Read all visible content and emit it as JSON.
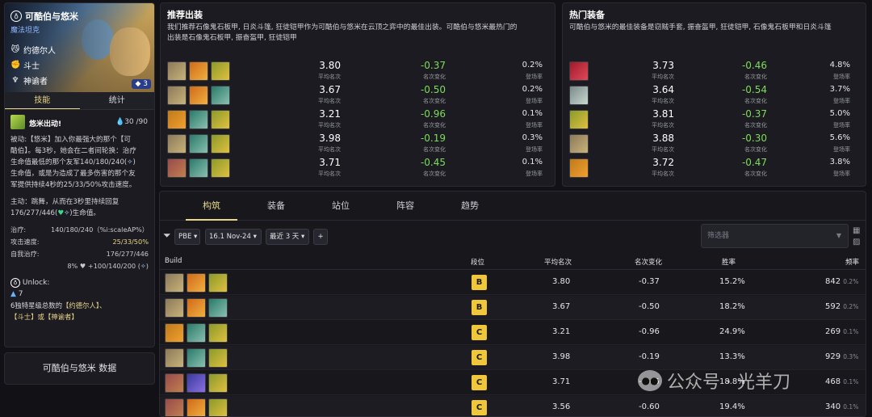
{
  "champion": {
    "name": "可酷伯与悠米",
    "type": "魔法坦克",
    "cost": "3",
    "traits": [
      "约德尔人",
      "斗士",
      "神谕者"
    ]
  },
  "tabs": {
    "skill": "技能",
    "stats": "统计"
  },
  "ability": {
    "name": "悠米出动!",
    "mana": "30 /90",
    "desc": [
      "被动:【悠米】加入你最强大的那个【可",
      "酷伯】。每3秒，她会在二者间轮换：治疗",
      "生命值最低的那个友军140/180/240(",
      "生命值，或是为造成了最多伤害的那个友",
      "军提供持续4秒的25/33/50%攻击速度。"
    ],
    "active": [
      "主动：跳舞，从而在3秒里持续回复",
      "176/277/446(",
      "生命值。"
    ]
  },
  "stats": [
    {
      "label": "治疗:",
      "value": "140/180/240（%i:scaleAP%）"
    },
    {
      "label": "攻击速度:",
      "value": "25/33/50%"
    },
    {
      "label": "自我治疗:",
      "value": "176/277/446"
    },
    {
      "label": "",
      "value": "8% ♥ +100/140/200 ("
    }
  ],
  "unlock": {
    "title": "Unlock:",
    "count": "7",
    "line1": "6独特星级总数的",
    "t1": "【约德尔人】、",
    "t2": "【斗士】或",
    "t3": "【神谕者】"
  },
  "data_title": "可酷伯与悠米 数据",
  "recommended": {
    "title": "推荐出装",
    "desc1": "我们推荐石像鬼石板甲, 日炎斗篷, 狂徒铠甲作为可酷伯与悠米在云顶之弈中的最佳出装。可酷伯与悠米最热门的",
    "desc2": "出装是石像鬼石板甲, 振奋盔甲, 狂徒铠甲",
    "rows": [
      {
        "items": [
          "c1",
          "c2",
          "c3"
        ],
        "avg": "3.80",
        "chg": "-0.37",
        "pick": "0.2%"
      },
      {
        "items": [
          "c1",
          "c2",
          "c4"
        ],
        "avg": "3.67",
        "chg": "-0.50",
        "pick": "0.2%"
      },
      {
        "items": [
          "c9",
          "c4",
          "c3"
        ],
        "avg": "3.21",
        "chg": "-0.96",
        "pick": "0.1%"
      },
      {
        "items": [
          "c1",
          "c4",
          "c3"
        ],
        "avg": "3.98",
        "chg": "-0.19",
        "pick": "0.3%"
      },
      {
        "items": [
          "c5",
          "c4",
          "c3"
        ],
        "avg": "3.71",
        "chg": "-0.45",
        "pick": "0.1%"
      }
    ],
    "sub_avg": "平均名次",
    "sub_chg": "名次变化",
    "sub_pick": "登场率"
  },
  "popular": {
    "title": "热门装备",
    "desc": "可酷伯与悠米的最佳装备是窃贼手套, 振奋盔甲, 狂徒铠甲, 石像鬼石板甲和日炎斗篷",
    "rows": [
      {
        "item": "c7",
        "avg": "3.73",
        "chg": "-0.46",
        "pick": "4.8%"
      },
      {
        "item": "c8",
        "avg": "3.64",
        "chg": "-0.54",
        "pick": "3.7%"
      },
      {
        "item": "c3",
        "avg": "3.81",
        "chg": "-0.37",
        "pick": "5.0%"
      },
      {
        "item": "c1",
        "avg": "3.88",
        "chg": "-0.30",
        "pick": "5.6%"
      },
      {
        "item": "c9",
        "avg": "3.72",
        "chg": "-0.47",
        "pick": "3.8%"
      }
    ]
  },
  "lower_tabs": [
    "构筑",
    "装备",
    "站位",
    "阵容",
    "趋势"
  ],
  "filters": {
    "region": "PBE",
    "patch": "16.1 Nov-24",
    "range": "最近 3 天",
    "add": "+",
    "search_placeholder": "筛选器"
  },
  "table": {
    "headers": [
      "Build",
      "段位",
      "平均名次",
      "名次变化",
      "胜率",
      "频率"
    ],
    "rows": [
      {
        "items": [
          "c1",
          "c2",
          "c3"
        ],
        "tier": "B",
        "avg": "3.80",
        "chg": "-0.37",
        "win": "15.2%",
        "freq": "842",
        "freq_pct": "0.2%"
      },
      {
        "items": [
          "c1",
          "c2",
          "c4"
        ],
        "tier": "B",
        "avg": "3.67",
        "chg": "-0.50",
        "win": "18.2%",
        "freq": "592",
        "freq_pct": "0.2%"
      },
      {
        "items": [
          "c9",
          "c4",
          "c3"
        ],
        "tier": "C",
        "avg": "3.21",
        "chg": "-0.96",
        "win": "24.9%",
        "freq": "269",
        "freq_pct": "0.1%"
      },
      {
        "items": [
          "c1",
          "c4",
          "c3"
        ],
        "tier": "C",
        "avg": "3.98",
        "chg": "-0.19",
        "win": "13.3%",
        "freq": "929",
        "freq_pct": "0.3%"
      },
      {
        "items": [
          "c5",
          "c6",
          "c3"
        ],
        "tier": "C",
        "avg": "3.71",
        "chg": "-0.45",
        "win": "18.8%",
        "freq": "468",
        "freq_pct": "0.1%"
      },
      {
        "items": [
          "c5",
          "c2",
          "c3"
        ],
        "tier": "C",
        "avg": "3.56",
        "chg": "-0.60",
        "win": "19.4%",
        "freq": "340",
        "freq_pct": "0.1%"
      }
    ]
  },
  "watermark": "公众号 · 光羊刀",
  "colors": {
    "accent": "#e9d58a",
    "positive": "#7edc5a",
    "tier": "#f0c63a"
  }
}
